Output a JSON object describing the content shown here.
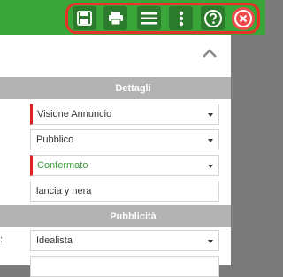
{
  "toolbar": {
    "buttons": [
      {
        "icon": "save-icon"
      },
      {
        "icon": "print-icon"
      },
      {
        "icon": "menu-icon"
      },
      {
        "icon": "more-vertical-icon"
      },
      {
        "icon": "help-icon"
      },
      {
        "icon": "close-icon"
      }
    ],
    "bar_color": "#3aa63a",
    "button_color": "#2c7a2c",
    "highlight_color": "#e4322a"
  },
  "sections": {
    "dettagli": {
      "title": "Dettagli",
      "fields": [
        {
          "value": "Visione Annuncio",
          "type": "select",
          "required": true
        },
        {
          "value": "Pubblico",
          "type": "select",
          "required": false
        },
        {
          "value": "Confermato",
          "type": "select",
          "required": true,
          "color": "#3c9a3c"
        },
        {
          "value": "lancia y nera",
          "type": "text",
          "required": false
        }
      ]
    },
    "pubblicita": {
      "title": "Pubblicità",
      "label_fragment": ":",
      "fields": [
        {
          "value": "Idealista",
          "type": "select",
          "required": false
        }
      ]
    }
  }
}
